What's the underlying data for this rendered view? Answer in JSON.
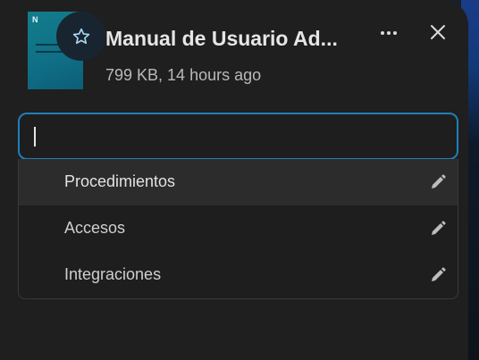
{
  "file": {
    "title": "Manual de Usuario Ad...",
    "meta": "799 KB, 14 hours ago",
    "thumbnail": {
      "logo_text": "N"
    }
  },
  "actions": {
    "favorite_icon": "star-outline-icon",
    "more_icon": "more-horizontal-icon",
    "close_icon": "close-icon"
  },
  "tag_input": {
    "value": "",
    "placeholder": ""
  },
  "suggestions": [
    {
      "label": "Procedimientos",
      "active": true
    },
    {
      "label": "Accesos",
      "active": false
    },
    {
      "label": "Integraciones",
      "active": false
    }
  ],
  "colors": {
    "panel": "#1f1f1f",
    "focus_border": "#1f7fb8",
    "thumbnail": "#127d8b",
    "highlight_row": "#2c2c2c"
  }
}
